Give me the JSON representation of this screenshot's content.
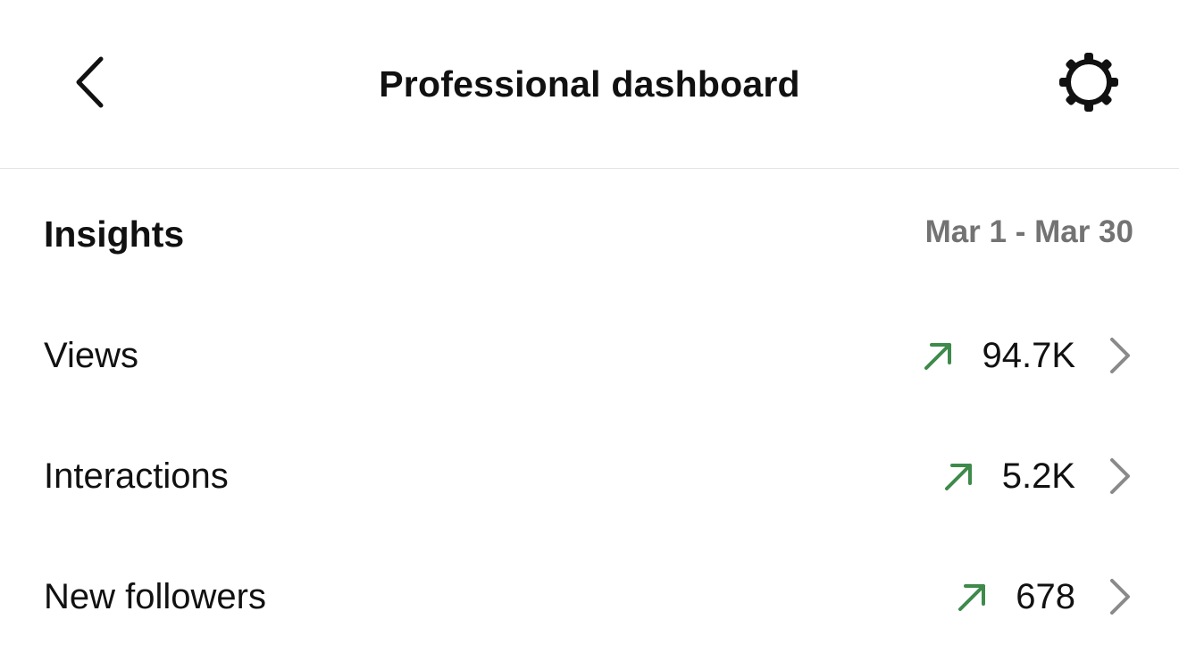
{
  "header": {
    "title": "Professional dashboard",
    "back_icon": "chevron-left-icon",
    "settings_icon": "gear-icon"
  },
  "insights": {
    "title": "Insights",
    "date_range": "Mar 1 - Mar 30",
    "rows": [
      {
        "label": "Views",
        "value": "94.7K",
        "trend": "up",
        "trend_icon": "arrow-up-right-icon"
      },
      {
        "label": "Interactions",
        "value": "5.2K",
        "trend": "up",
        "trend_icon": "arrow-up-right-icon"
      },
      {
        "label": "New followers",
        "value": "678",
        "trend": "up",
        "trend_icon": "arrow-up-right-icon"
      }
    ]
  },
  "colors": {
    "trend_up": "#3e8a4a",
    "secondary_text": "#737373",
    "chevron": "#8a8a8a",
    "divider": "#e4e4e4"
  }
}
